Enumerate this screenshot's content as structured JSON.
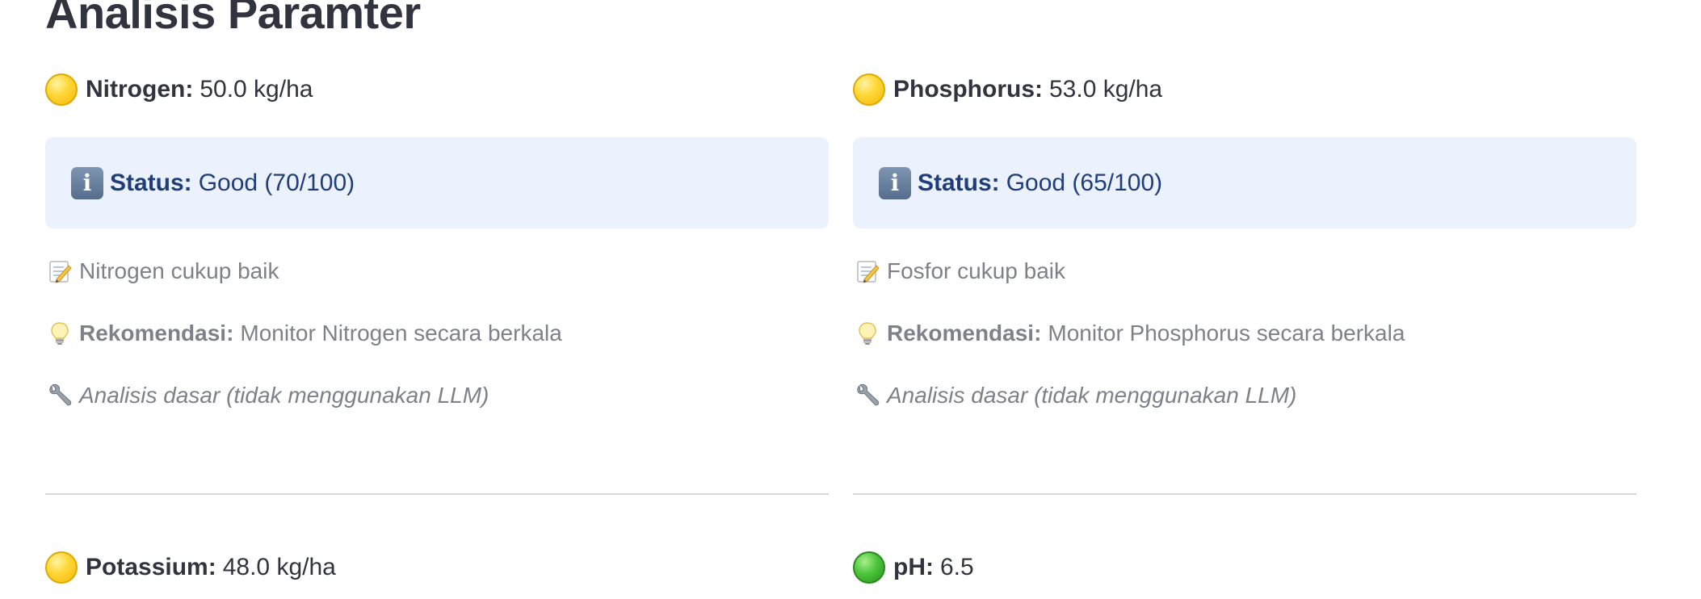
{
  "page": {
    "title": "Analisis Paramter"
  },
  "columns": [
    {
      "parameter": {
        "name": "Nitrogen:",
        "value": "50.0 kg/ha",
        "indicator_color": "#ffd93b",
        "indicator_icon": "yellow-circle-icon"
      },
      "status": {
        "label": "Status:",
        "value": "Good (70/100)",
        "icon": "info-icon"
      },
      "note": {
        "icon": "memo-icon",
        "text": "Nitrogen cukup baik"
      },
      "recommendation": {
        "icon": "lightbulb-icon",
        "label": "Rekomendasi:",
        "text": "Monitor Nitrogen secara berkala"
      },
      "method": {
        "icon": "wrench-icon",
        "text": "Analisis dasar (tidak menggunakan LLM)"
      },
      "next_parameter": {
        "name": "Potassium:",
        "value": "48.0 kg/ha",
        "indicator_color": "#ffd93b",
        "indicator_icon": "yellow-circle-icon"
      }
    },
    {
      "parameter": {
        "name": "Phosphorus:",
        "value": "53.0 kg/ha",
        "indicator_color": "#ffd93b",
        "indicator_icon": "yellow-circle-icon"
      },
      "status": {
        "label": "Status:",
        "value": "Good (65/100)",
        "icon": "info-icon"
      },
      "note": {
        "icon": "memo-icon",
        "text": "Fosfor cukup baik"
      },
      "recommendation": {
        "icon": "lightbulb-icon",
        "label": "Rekomendasi:",
        "text": "Monitor Phosphorus secara berkala"
      },
      "method": {
        "icon": "wrench-icon",
        "text": "Analisis dasar (tidak menggunakan LLM)"
      },
      "next_parameter": {
        "name": "pH:",
        "value": "6.5",
        "indicator_color": "#4cc43a",
        "indicator_icon": "green-circle-icon"
      }
    }
  ],
  "colors": {
    "text": "#31333f",
    "muted_text": "#7e808a",
    "status_background": "#ecf2fd",
    "status_text": "#1f3d7a",
    "divider": "#d5d7dd"
  }
}
